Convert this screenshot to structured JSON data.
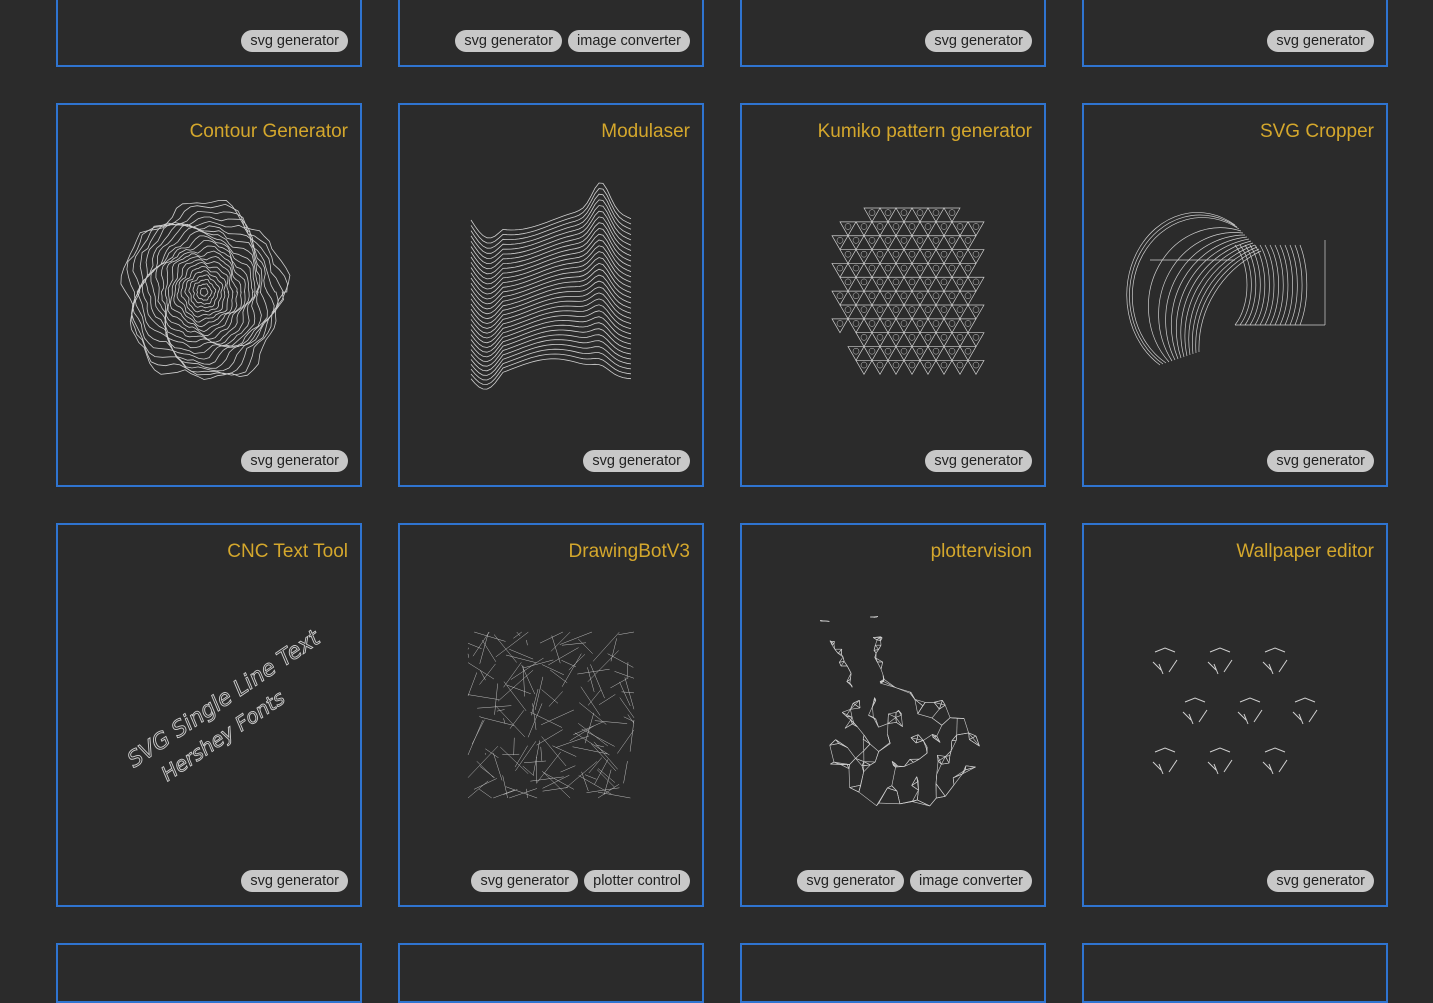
{
  "colors": {
    "accent_border": "#2f74d0",
    "title": "#d4a72c",
    "tag_bg": "#c8c8c8",
    "background": "#2b2b2b"
  },
  "top_row_partial": [
    {
      "tags": [
        "svg generator"
      ]
    },
    {
      "tags": [
        "svg generator",
        "image converter"
      ]
    },
    {
      "tags": [
        "svg generator"
      ]
    },
    {
      "tags": [
        "svg generator"
      ]
    }
  ],
  "row1": [
    {
      "title": "Contour Generator",
      "thumbnail_icon": "contour-rings-icon",
      "tags": [
        "svg generator"
      ]
    },
    {
      "title": "Modulaser",
      "thumbnail_icon": "wave-lines-icon",
      "tags": [
        "svg generator"
      ]
    },
    {
      "title": "Kumiko pattern generator",
      "thumbnail_icon": "kumiko-lattice-icon",
      "tags": [
        "svg generator"
      ]
    },
    {
      "title": "SVG Cropper",
      "thumbnail_icon": "cropped-arcs-icon",
      "tags": [
        "svg generator"
      ]
    }
  ],
  "row2": [
    {
      "title": "CNC Text Tool",
      "thumbnail_icon": "single-line-text-icon",
      "thumb_text_1": "SVG Single Line Text",
      "thumb_text_2": "Hershey Fonts",
      "tags": [
        "svg generator"
      ]
    },
    {
      "title": "DrawingBotV3",
      "thumbnail_icon": "sketch-portrait-icon",
      "tags": [
        "svg generator",
        "plotter control"
      ]
    },
    {
      "title": "plottervision",
      "thumbnail_icon": "wireframe-bunny-icon",
      "tags": [
        "svg generator",
        "image converter"
      ]
    },
    {
      "title": "Wallpaper editor",
      "thumbnail_icon": "wallpaper-pattern-icon",
      "tags": [
        "svg generator"
      ]
    }
  ]
}
